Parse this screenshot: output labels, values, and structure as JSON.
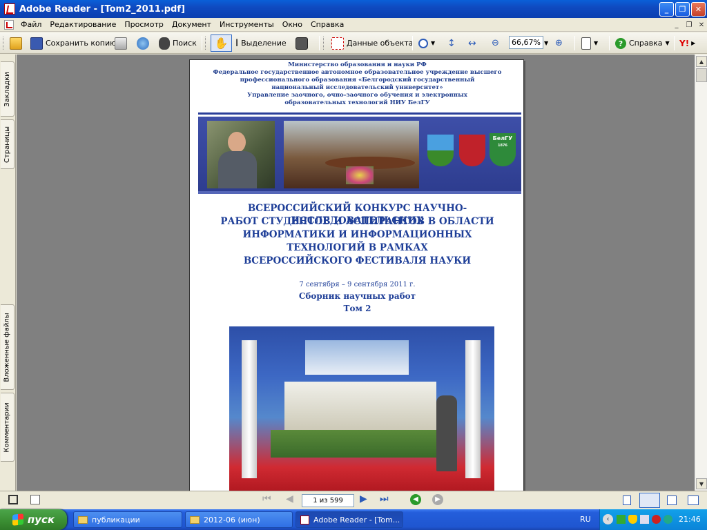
{
  "window": {
    "title": "Adobe Reader - [Tom2_2011.pdf]"
  },
  "menu": {
    "items": [
      "Файл",
      "Редактирование",
      "Просмотр",
      "Документ",
      "Инструменты",
      "Окно",
      "Справка"
    ]
  },
  "toolbar": {
    "save_copy": "Сохранить копию",
    "search": "Поиск",
    "select": "Выделение",
    "object_data": "Данные объекта",
    "zoom": "66,67%",
    "help": "Справка"
  },
  "side_tabs": {
    "bookmarks": "Закладки",
    "pages": "Страницы",
    "attachments": "Вложенные файлы",
    "comments": "Комментарии"
  },
  "document": {
    "header_lines": [
      "Министерство образования и науки РФ",
      "Федеральное государственное автономное образовательное учреждение высшего",
      "профессионального образования «Белгородский государственный",
      "национальный исследовательский университет»",
      "Управление заочного, очно-заочного обучения и электронных",
      "образовательных технологий НИУ БелГУ"
    ],
    "logo_text": "БелГУ",
    "logo_year": "1876",
    "title_lines": [
      "ВСЕРОССИЙСКИЙ КОНКУРС НАУЧНО-ИССЛЕДОВАТЕЛЬСКИХ",
      "РАБОТ СТУДЕНТОВ И АСПИРАНТОВ В ОБЛАСТИ",
      "ИНФОРМАТИКИ И ИНФОРМАЦИОННЫХ",
      "ТЕХНОЛОГИЙ В РАМКАХ",
      "ВСЕРОССИЙСКОГО ФЕСТИВАЛЯ НАУКИ"
    ],
    "dates": "7 сентября – 9 сентября 2011 г.",
    "collection": "Сборник научных работ",
    "volume": "Том 2"
  },
  "navigation": {
    "page_indicator": "1 из 599"
  },
  "taskbar": {
    "start": "пуск",
    "tasks": [
      "публикации",
      "2012-06 (июн)",
      "Adobe Reader - [Tom..."
    ],
    "lang": "RU",
    "clock": "21:46"
  },
  "colors": {
    "title_blue": "#1f3f98",
    "xp_blue": "#245edb",
    "start_green": "#3a8d32"
  }
}
